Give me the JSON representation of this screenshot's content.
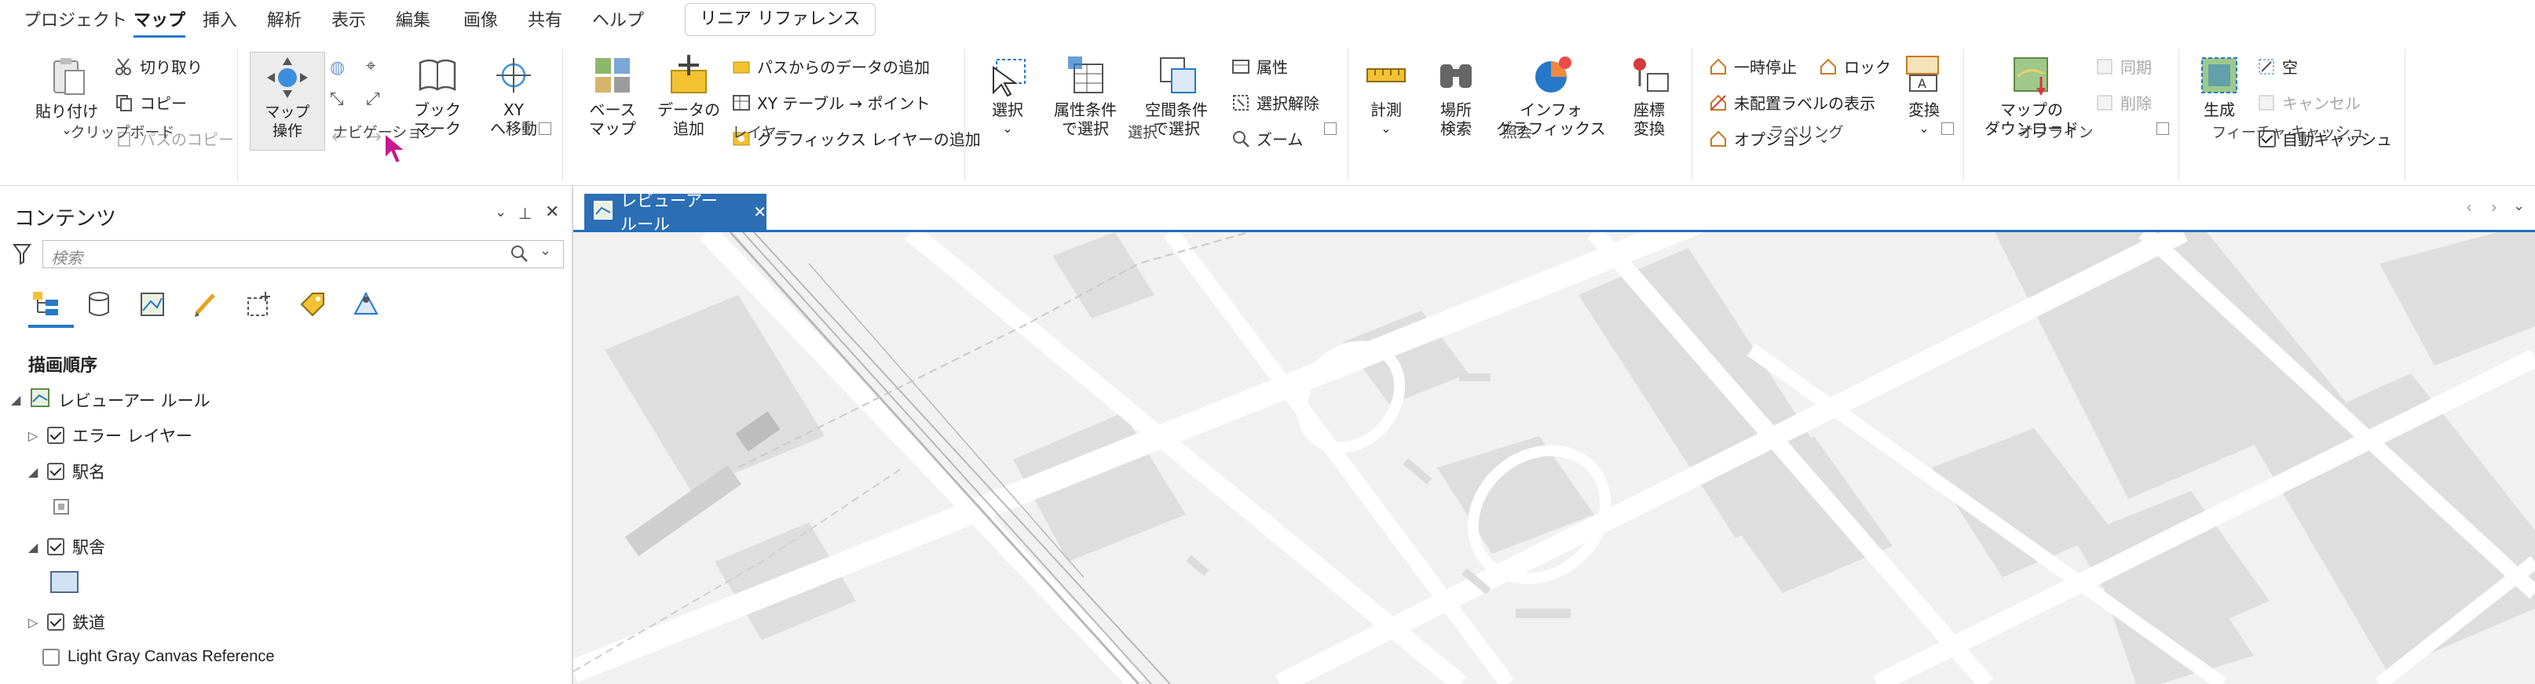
{
  "menu": {
    "tabs": [
      "プロジェクト",
      "マップ",
      "挿入",
      "解析",
      "表示",
      "編集",
      "画像",
      "共有",
      "ヘルプ"
    ],
    "active_tab": "マップ",
    "linear_reference": "リニア リファレンス"
  },
  "ribbon": {
    "clipboard": {
      "paste": "貼り付け",
      "cut": "切り取り",
      "copy": "コピー",
      "copy_path": "パスのコピー",
      "label": "クリップボード"
    },
    "navigation": {
      "map_op": "マップ\n操作",
      "bookmark": "ブック\nマーク",
      "xy": "XY\nへ移動",
      "label": "ナビゲーション"
    },
    "layer": {
      "basemap": "ベース\nマップ",
      "add_data": "データの\n追加",
      "add_from_path": "パスからのデータの追加",
      "xy_table": "XY テーブル → ポイント",
      "add_graphics": "グラフィックス レイヤーの追加",
      "label": "レイヤー"
    },
    "selection": {
      "select": "選択",
      "by_attr": "属性条件\nで選択",
      "by_location": "空間条件\nで選択",
      "attributes": "属性",
      "clear": "選択解除",
      "zoom": "ズーム",
      "label": "選択"
    },
    "inquiry": {
      "measure": "計測",
      "locate": "場所\n検索",
      "infographics": "インフォ\nグラフィックス",
      "coord": "座標\n変換",
      "label": "照会"
    },
    "labeling": {
      "pause": "一時停止",
      "lock": "ロック",
      "unplaced": "未配置ラベルの表示",
      "options": "オプション",
      "convert": "変換",
      "label": "ラベリング"
    },
    "offline": {
      "download": "マップの\nダウンロード",
      "sync": "同期",
      "remove": "削除",
      "label": "オフライン"
    },
    "feature_cache": {
      "generate": "生成",
      "empty": "空",
      "cancel": "キャンセル",
      "auto_cache": "自動キャッシュ",
      "label": "フィーチャ キャッシュ"
    }
  },
  "contents": {
    "title": "コンテンツ",
    "search_placeholder": "検索",
    "draw_order": "描画順序",
    "map_name": "レビューアー ルール",
    "layers": [
      {
        "name": "エラー レイヤー",
        "checked": true,
        "expanded": false
      },
      {
        "name": "駅名",
        "checked": true,
        "expanded": true
      },
      {
        "name": "駅舎",
        "checked": true,
        "expanded": true
      },
      {
        "name": "鉄道",
        "checked": true,
        "expanded": false
      },
      {
        "name": "Light Gray Canvas Reference",
        "checked": false,
        "expanded": false
      }
    ]
  },
  "map_view": {
    "tab_label": "レビューアー ルール"
  },
  "colors": {
    "accent": "#2678c9",
    "map_tab": "#2c6fb5",
    "map_bg": "#f1f1f1",
    "cursor": "#c8188f"
  }
}
